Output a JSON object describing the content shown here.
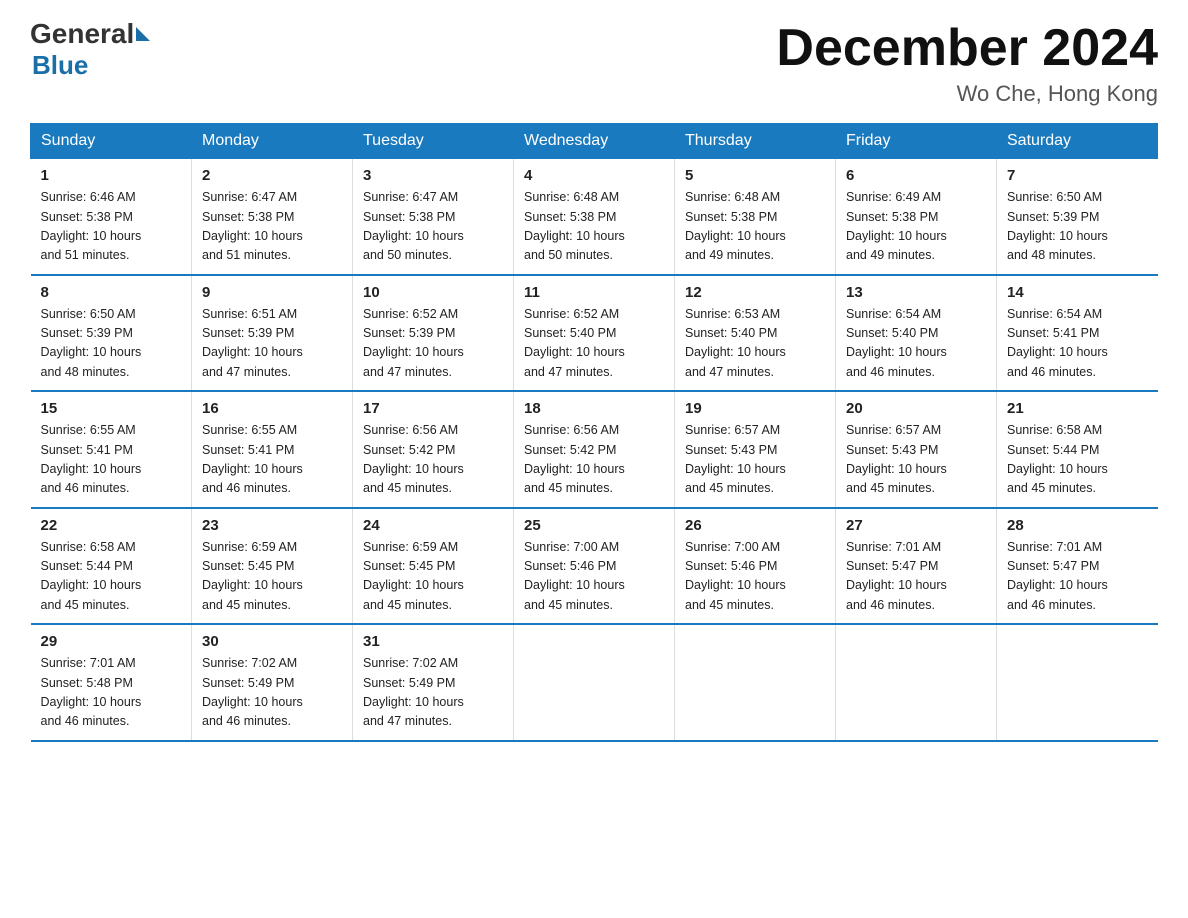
{
  "logo": {
    "general": "General",
    "blue": "Blue"
  },
  "title": "December 2024",
  "location": "Wo Che, Hong Kong",
  "days_header": [
    "Sunday",
    "Monday",
    "Tuesday",
    "Wednesday",
    "Thursday",
    "Friday",
    "Saturday"
  ],
  "weeks": [
    [
      {
        "day": "1",
        "sunrise": "6:46 AM",
        "sunset": "5:38 PM",
        "daylight": "10 hours and 51 minutes."
      },
      {
        "day": "2",
        "sunrise": "6:47 AM",
        "sunset": "5:38 PM",
        "daylight": "10 hours and 51 minutes."
      },
      {
        "day": "3",
        "sunrise": "6:47 AM",
        "sunset": "5:38 PM",
        "daylight": "10 hours and 50 minutes."
      },
      {
        "day": "4",
        "sunrise": "6:48 AM",
        "sunset": "5:38 PM",
        "daylight": "10 hours and 50 minutes."
      },
      {
        "day": "5",
        "sunrise": "6:48 AM",
        "sunset": "5:38 PM",
        "daylight": "10 hours and 49 minutes."
      },
      {
        "day": "6",
        "sunrise": "6:49 AM",
        "sunset": "5:38 PM",
        "daylight": "10 hours and 49 minutes."
      },
      {
        "day": "7",
        "sunrise": "6:50 AM",
        "sunset": "5:39 PM",
        "daylight": "10 hours and 48 minutes."
      }
    ],
    [
      {
        "day": "8",
        "sunrise": "6:50 AM",
        "sunset": "5:39 PM",
        "daylight": "10 hours and 48 minutes."
      },
      {
        "day": "9",
        "sunrise": "6:51 AM",
        "sunset": "5:39 PM",
        "daylight": "10 hours and 47 minutes."
      },
      {
        "day": "10",
        "sunrise": "6:52 AM",
        "sunset": "5:39 PM",
        "daylight": "10 hours and 47 minutes."
      },
      {
        "day": "11",
        "sunrise": "6:52 AM",
        "sunset": "5:40 PM",
        "daylight": "10 hours and 47 minutes."
      },
      {
        "day": "12",
        "sunrise": "6:53 AM",
        "sunset": "5:40 PM",
        "daylight": "10 hours and 47 minutes."
      },
      {
        "day": "13",
        "sunrise": "6:54 AM",
        "sunset": "5:40 PM",
        "daylight": "10 hours and 46 minutes."
      },
      {
        "day": "14",
        "sunrise": "6:54 AM",
        "sunset": "5:41 PM",
        "daylight": "10 hours and 46 minutes."
      }
    ],
    [
      {
        "day": "15",
        "sunrise": "6:55 AM",
        "sunset": "5:41 PM",
        "daylight": "10 hours and 46 minutes."
      },
      {
        "day": "16",
        "sunrise": "6:55 AM",
        "sunset": "5:41 PM",
        "daylight": "10 hours and 46 minutes."
      },
      {
        "day": "17",
        "sunrise": "6:56 AM",
        "sunset": "5:42 PM",
        "daylight": "10 hours and 45 minutes."
      },
      {
        "day": "18",
        "sunrise": "6:56 AM",
        "sunset": "5:42 PM",
        "daylight": "10 hours and 45 minutes."
      },
      {
        "day": "19",
        "sunrise": "6:57 AM",
        "sunset": "5:43 PM",
        "daylight": "10 hours and 45 minutes."
      },
      {
        "day": "20",
        "sunrise": "6:57 AM",
        "sunset": "5:43 PM",
        "daylight": "10 hours and 45 minutes."
      },
      {
        "day": "21",
        "sunrise": "6:58 AM",
        "sunset": "5:44 PM",
        "daylight": "10 hours and 45 minutes."
      }
    ],
    [
      {
        "day": "22",
        "sunrise": "6:58 AM",
        "sunset": "5:44 PM",
        "daylight": "10 hours and 45 minutes."
      },
      {
        "day": "23",
        "sunrise": "6:59 AM",
        "sunset": "5:45 PM",
        "daylight": "10 hours and 45 minutes."
      },
      {
        "day": "24",
        "sunrise": "6:59 AM",
        "sunset": "5:45 PM",
        "daylight": "10 hours and 45 minutes."
      },
      {
        "day": "25",
        "sunrise": "7:00 AM",
        "sunset": "5:46 PM",
        "daylight": "10 hours and 45 minutes."
      },
      {
        "day": "26",
        "sunrise": "7:00 AM",
        "sunset": "5:46 PM",
        "daylight": "10 hours and 45 minutes."
      },
      {
        "day": "27",
        "sunrise": "7:01 AM",
        "sunset": "5:47 PM",
        "daylight": "10 hours and 46 minutes."
      },
      {
        "day": "28",
        "sunrise": "7:01 AM",
        "sunset": "5:47 PM",
        "daylight": "10 hours and 46 minutes."
      }
    ],
    [
      {
        "day": "29",
        "sunrise": "7:01 AM",
        "sunset": "5:48 PM",
        "daylight": "10 hours and 46 minutes."
      },
      {
        "day": "30",
        "sunrise": "7:02 AM",
        "sunset": "5:49 PM",
        "daylight": "10 hours and 46 minutes."
      },
      {
        "day": "31",
        "sunrise": "7:02 AM",
        "sunset": "5:49 PM",
        "daylight": "10 hours and 47 minutes."
      },
      null,
      null,
      null,
      null
    ]
  ],
  "sunrise_label": "Sunrise:",
  "sunset_label": "Sunset:",
  "daylight_label": "Daylight:"
}
